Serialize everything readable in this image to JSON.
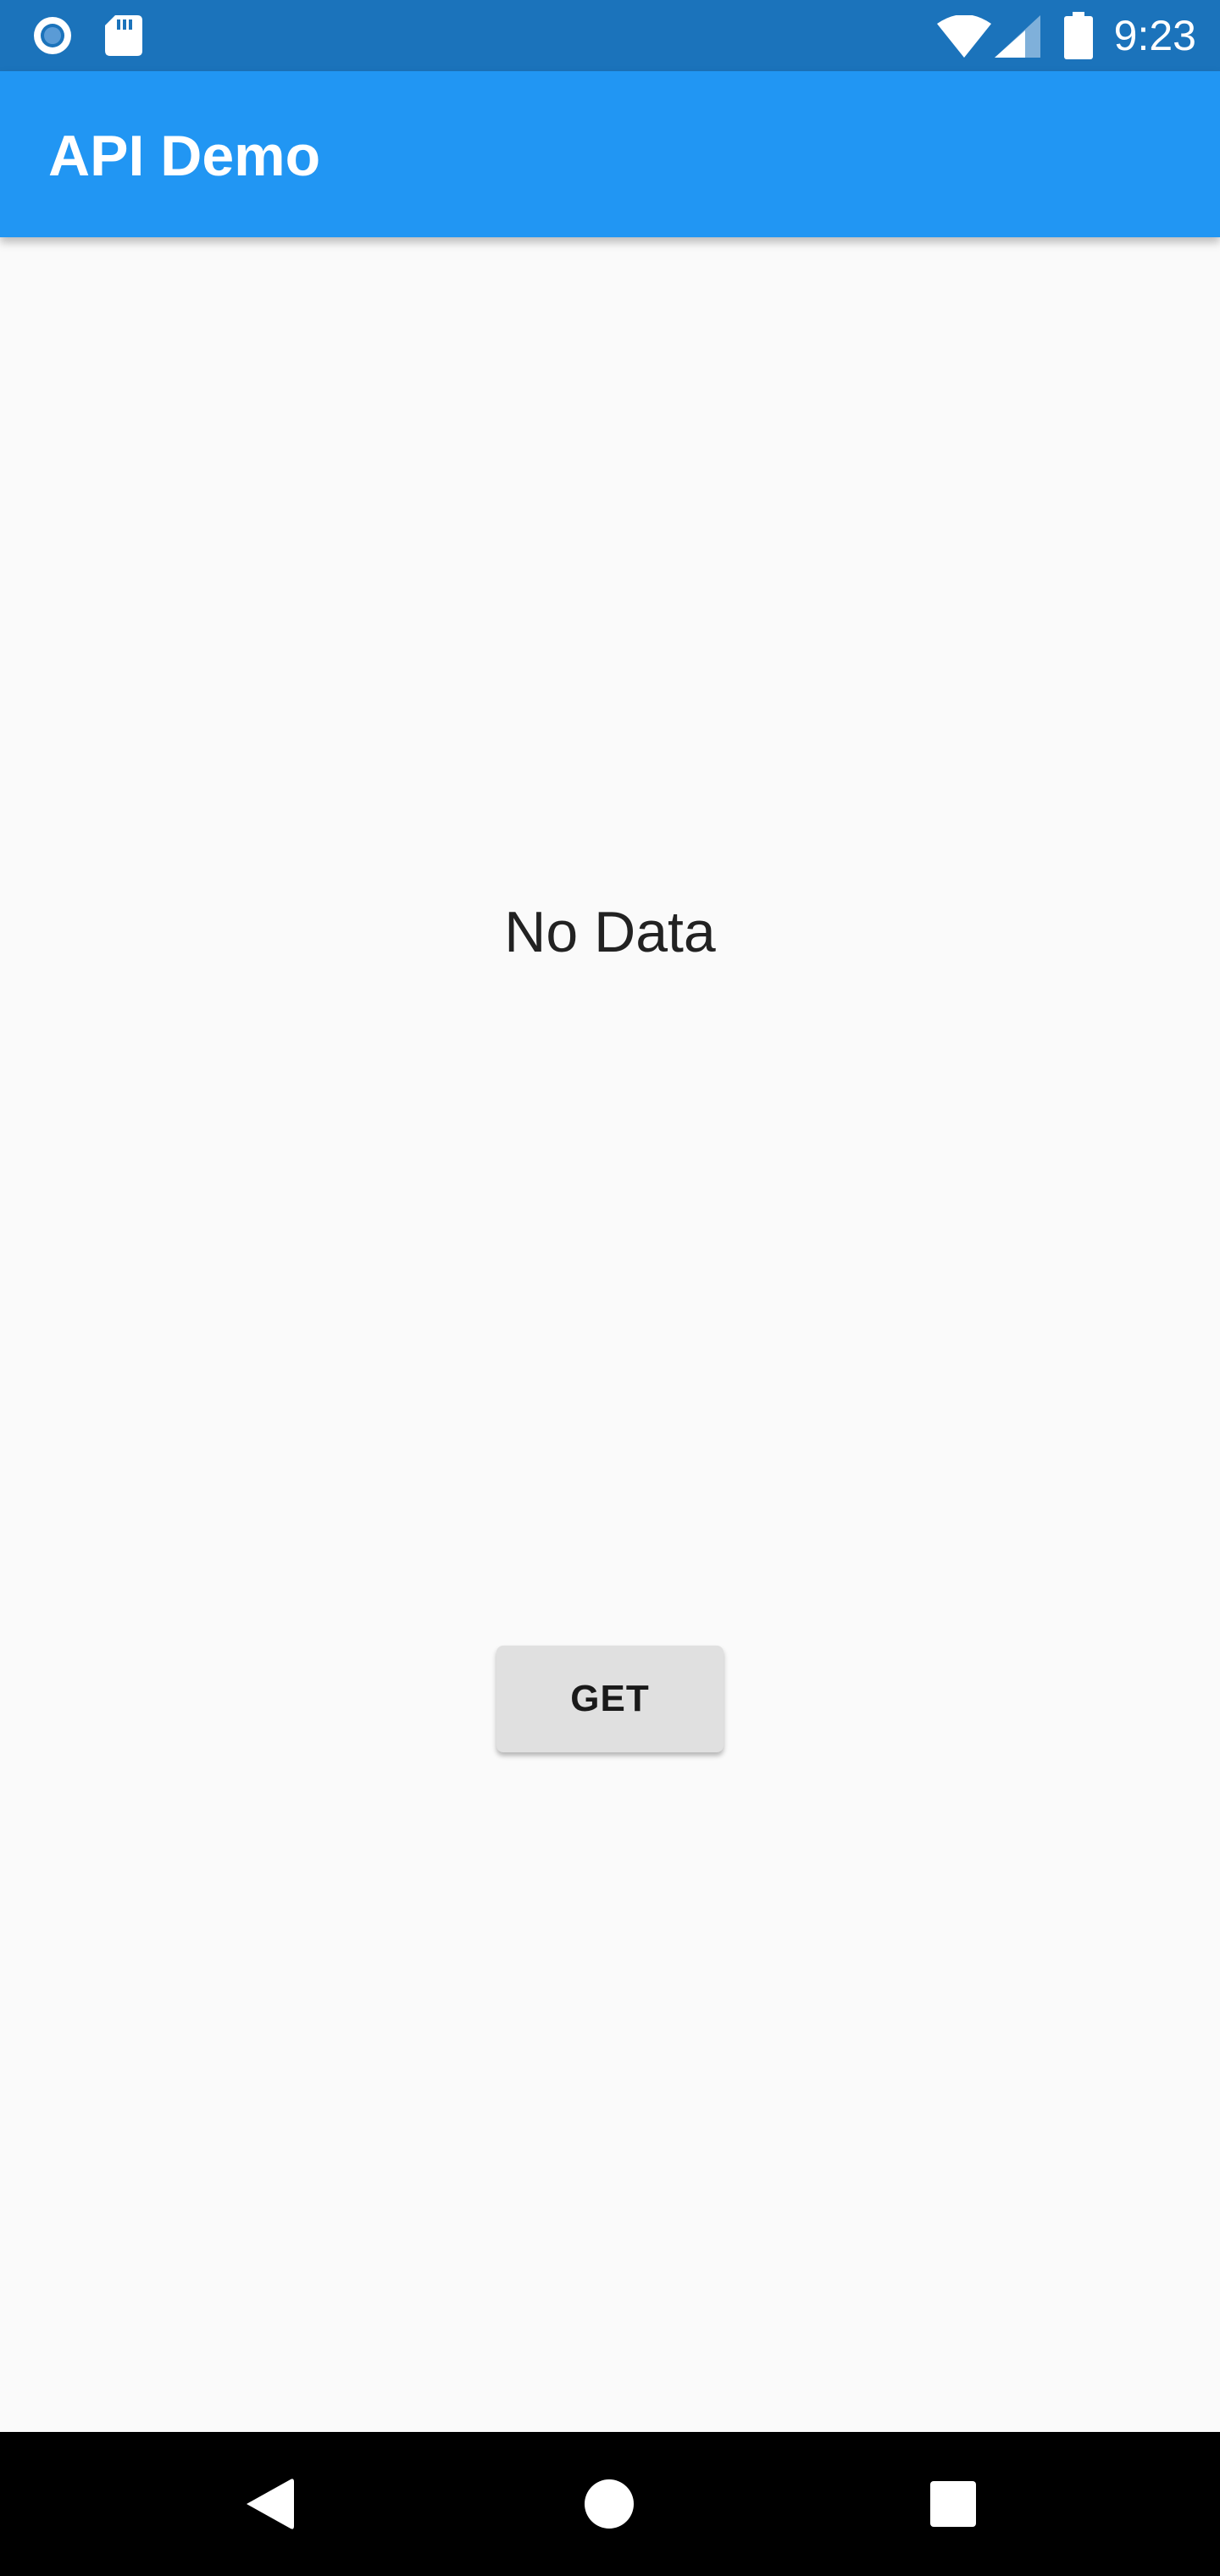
{
  "status_bar": {
    "time": "9:23",
    "background_color": "#1b73bb",
    "left_icons": [
      "record-icon",
      "sd-card-icon"
    ],
    "right_icons": [
      "wifi-icon",
      "cellular-signal-icon",
      "battery-icon"
    ]
  },
  "app_bar": {
    "title": "API Demo",
    "background_color": "#2196f3"
  },
  "main": {
    "status_text": "No Data",
    "get_button_label": "GET"
  },
  "nav_bar": {
    "items": [
      "back-icon",
      "home-icon",
      "recents-icon"
    ]
  }
}
